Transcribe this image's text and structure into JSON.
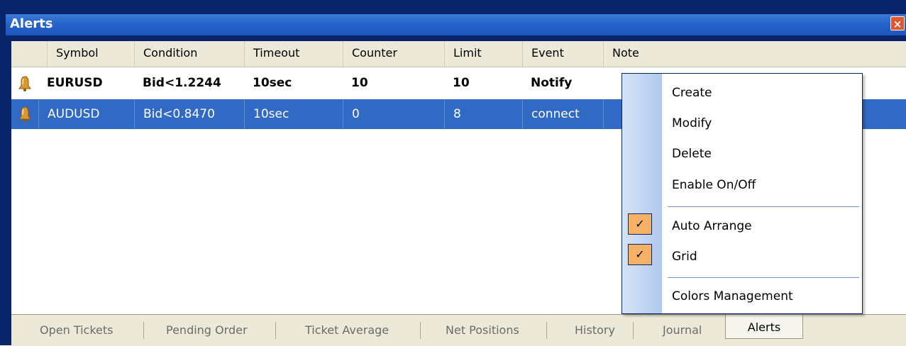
{
  "window": {
    "title": "Alerts",
    "close_label": "×"
  },
  "columns": [
    "Symbol",
    "Condition",
    "Timeout",
    "Counter",
    "Limit",
    "Event",
    "Note"
  ],
  "rows": [
    {
      "symbol": "EURUSD",
      "condition": "Bid<1.2244",
      "timeout": "10sec",
      "counter": "10",
      "limit": "10",
      "event": "Notify",
      "note": "",
      "state": "bold",
      "icon": "bell-icon"
    },
    {
      "symbol": "AUDUSD",
      "condition": "Bid<0.8470",
      "timeout": "10sec",
      "counter": "0",
      "limit": "8",
      "event": "connect",
      "note": "",
      "state": "selected",
      "icon": "bell-icon"
    }
  ],
  "context_menu": {
    "items": [
      {
        "label": "Create"
      },
      {
        "label": "Modify"
      },
      {
        "label": "Delete"
      },
      {
        "label": "Enable On/Off"
      },
      {
        "label": "Auto Arrange",
        "checked": true
      },
      {
        "label": "Grid",
        "checked": true
      },
      {
        "label": "Colors Management"
      }
    ],
    "check_glyph": "✓"
  },
  "tabs": [
    {
      "label": "Open Tickets"
    },
    {
      "label": "Pending Order"
    },
    {
      "label": "Ticket Average"
    },
    {
      "label": "Net Positions"
    },
    {
      "label": "History"
    },
    {
      "label": "Journal"
    },
    {
      "label": "Alerts",
      "active": true
    }
  ],
  "colors": {
    "selection": "#316ac5",
    "titlebar": "#2562c8",
    "menu_check": "#f5b267",
    "chrome": "#ece9d8"
  }
}
